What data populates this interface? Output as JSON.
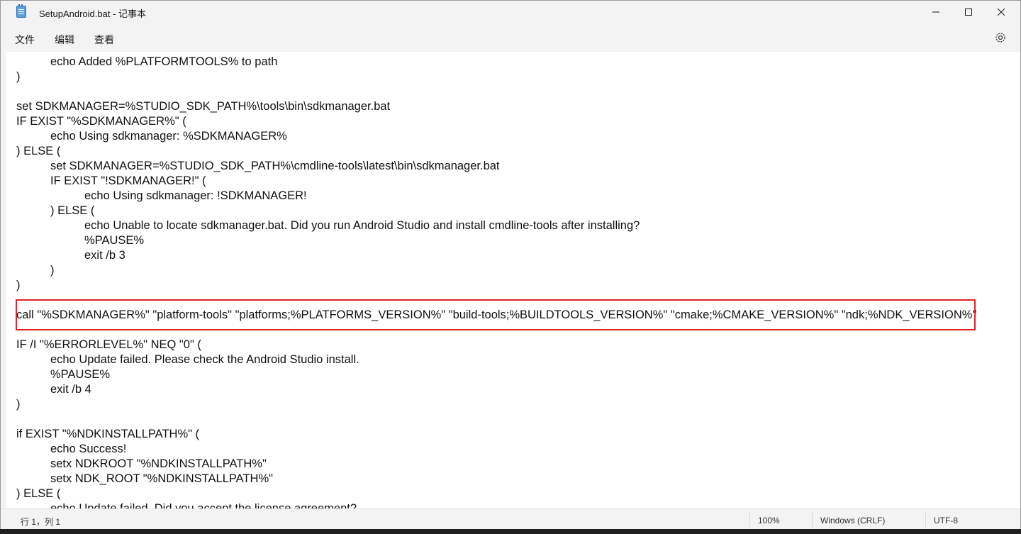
{
  "window": {
    "title": "SetupAndroid.bat - 记事本"
  },
  "menu": {
    "file": "文件",
    "edit": "编辑",
    "view": "查看"
  },
  "icons": {
    "app": "notepad-icon",
    "minimize": "minimize-icon",
    "maximize": "maximize-icon",
    "close": "close-icon",
    "settings": "gear-icon"
  },
  "editor": {
    "lines": [
      "echo Added %PLATFORMTOOLS% to path",
      ")",
      "",
      "set SDKMANAGER=%STUDIO_SDK_PATH%\\tools\\bin\\sdkmanager.bat",
      "IF EXIST \"%SDKMANAGER%\" (",
      "echo Using sdkmanager: %SDKMANAGER%",
      ") ELSE (",
      "set SDKMANAGER=%STUDIO_SDK_PATH%\\cmdline-tools\\latest\\bin\\sdkmanager.bat",
      "IF EXIST \"!SDKMANAGER!\" (",
      "echo Using sdkmanager: !SDKMANAGER!",
      ") ELSE (",
      "echo Unable to locate sdkmanager.bat. Did you run Android Studio and install cmdline-tools after installing?",
      "%PAUSE%",
      "exit /b 3",
      ")",
      ")",
      "call \"%SDKMANAGER%\" \"platform-tools\" \"platforms;%PLATFORMS_VERSION%\" \"build-tools;%BUILDTOOLS_VERSION%\" \"cmake;%CMAKE_VERSION%\" \"ndk;%NDK_VERSION%\"",
      "IF /I \"%ERRORLEVEL%\" NEQ \"0\" (",
      "echo Update failed. Please check the Android Studio install.",
      "%PAUSE%",
      "exit /b 4",
      ")",
      "if EXIST \"%NDKINSTALLPATH%\" (",
      "echo Success!",
      "setx NDKROOT \"%NDKINSTALLPATH%\"",
      "setx NDK_ROOT \"%NDKINSTALLPATH%\"",
      ") ELSE (",
      "echo Update failed. Did you accept the license agreement?"
    ]
  },
  "status": {
    "position": "行 1，列 1",
    "zoom": "100%",
    "line_ending": "Windows (CRLF)",
    "encoding": "UTF-8"
  },
  "colors": {
    "highlight_border": "#e0252b",
    "chrome_bg": "#f3f3f3"
  }
}
